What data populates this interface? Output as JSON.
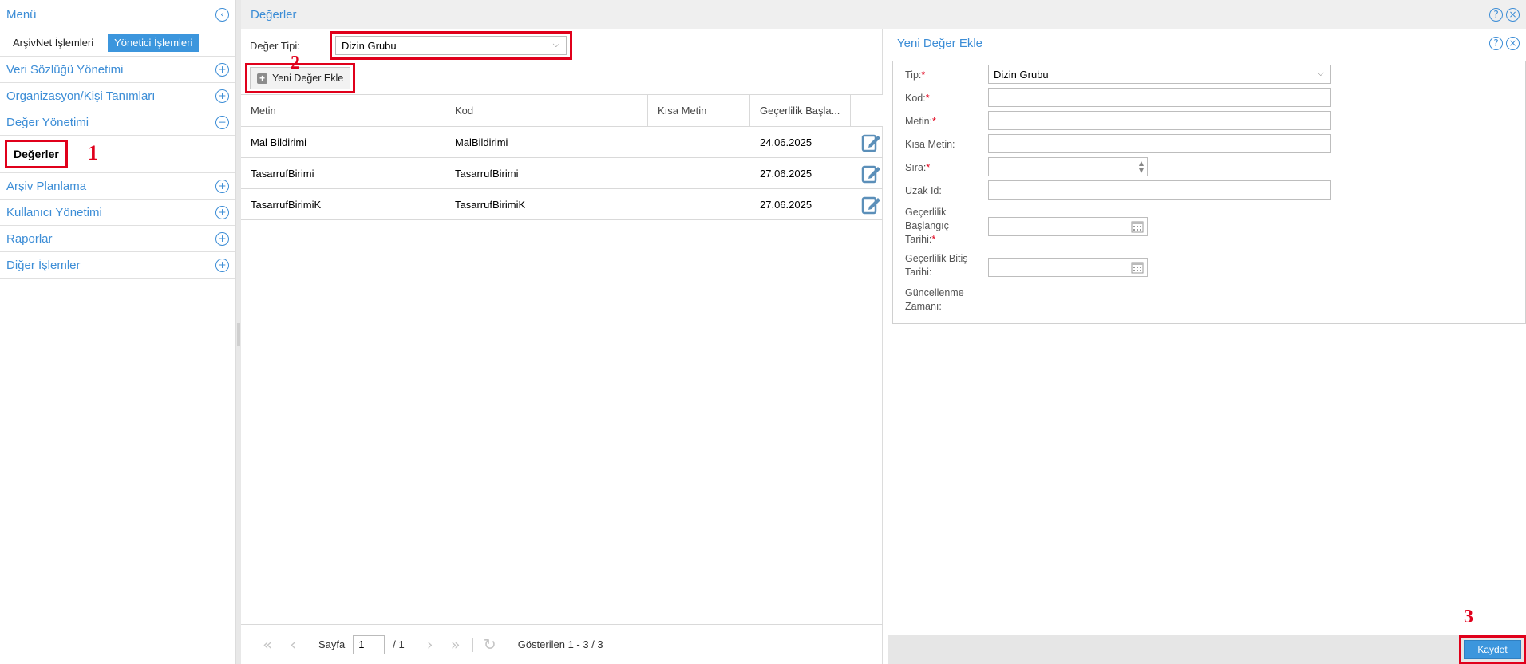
{
  "menu": {
    "title": "Menü",
    "tabs": [
      "ArşivNet İşlemleri",
      "Yönetici İşlemleri"
    ],
    "items": [
      {
        "label": "Veri Sözlüğü Yönetimi",
        "expand": "+"
      },
      {
        "label": "Organizasyon/Kişi Tanımları",
        "expand": "+"
      },
      {
        "label": "Değer Yönetimi",
        "expand": "−"
      },
      {
        "label": "Arşiv Planlama",
        "expand": "+"
      },
      {
        "label": "Kullanıcı Yönetimi",
        "expand": "+"
      },
      {
        "label": "Raporlar",
        "expand": "+"
      },
      {
        "label": "Diğer İşlemler",
        "expand": "+"
      }
    ],
    "sub_item": "Değerler"
  },
  "markers": [
    "1",
    "2",
    "3"
  ],
  "header": {
    "title": "Değerler"
  },
  "filter": {
    "label": "Değer Tipi:",
    "value": "Dizin Grubu"
  },
  "toolbar": {
    "add_label": "Yeni Değer Ekle"
  },
  "grid": {
    "columns": [
      "Metin",
      "Kod",
      "Kısa Metin",
      "Geçerlilik Başla..."
    ],
    "rows": [
      {
        "metin": "Mal Bildirimi",
        "kod": "MalBildirimi",
        "kisa": "",
        "tarih": "24.06.2025"
      },
      {
        "metin": "TasarrufBirimi",
        "kod": "TasarrufBirimi",
        "kisa": "",
        "tarih": "27.06.2025"
      },
      {
        "metin": "TasarrufBirimiK",
        "kod": "TasarrufBirimiK",
        "kisa": "",
        "tarih": "27.06.2025"
      }
    ]
  },
  "pager": {
    "page_label": "Sayfa",
    "page_value": "1",
    "total": "/ 1",
    "showing": "Gösterilen 1 - 3 / 3"
  },
  "form": {
    "title": "Yeni Değer Ekle",
    "fields": {
      "tip": {
        "label": "Tip:",
        "value": "Dizin Grubu"
      },
      "kod": {
        "label": "Kod:"
      },
      "metin": {
        "label": "Metin:"
      },
      "kisa_metin": {
        "label": "Kısa Metin:"
      },
      "sira": {
        "label": "Sıra:"
      },
      "uzak_id": {
        "label": "Uzak Id:"
      },
      "baslangic": {
        "label": "Geçerlilik Başlangıç Tarihi:"
      },
      "bitis": {
        "label": "Geçerlilik Bitiş Tarihi:"
      },
      "guncelleme": {
        "label": "Güncellenme Zamanı:"
      }
    },
    "required_mark": "*",
    "save_label": "Kaydet"
  },
  "icons": {
    "help": "?",
    "close": "×",
    "collapse": "‹",
    "chevron": "⌵"
  },
  "colors": {
    "accent": "#3c96dd",
    "link": "#3c8dd6",
    "highlight": "#e0001b"
  }
}
